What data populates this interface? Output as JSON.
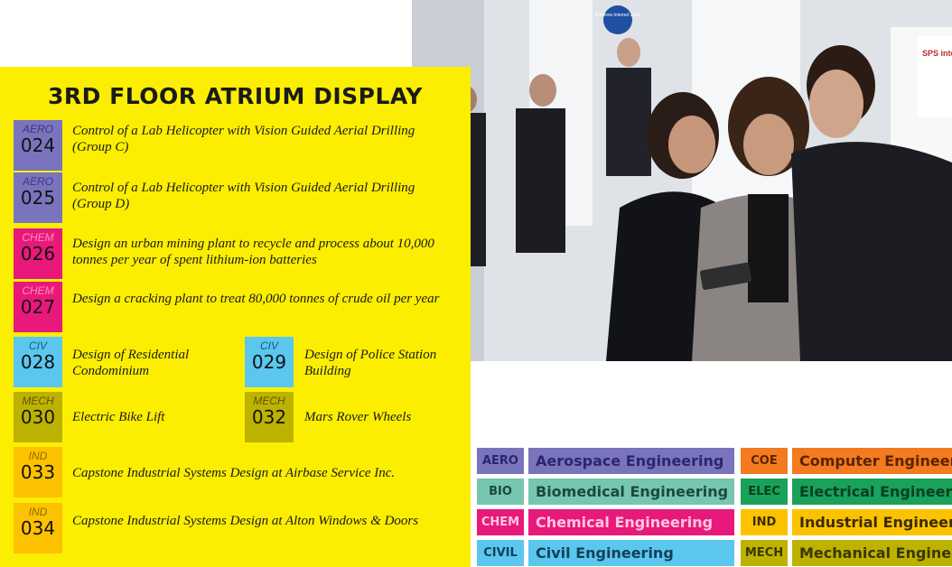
{
  "panel": {
    "title": "3RD FLOOR ATRIUM DISPLAY",
    "projects": [
      {
        "dept": "AERO",
        "num": "024",
        "title": "Control of a Lab Helicopter with Vision Guided Aerial Drilling (Group C)"
      },
      {
        "dept": "AERO",
        "num": "025",
        "title": "Control of a Lab Helicopter with Vision Guided Aerial Drilling (Group D)"
      },
      {
        "dept": "CHEM",
        "num": "026",
        "title": "Design an urban mining plant to recycle and process about 10,000 tonnes per year of spent lithium-ion batteries"
      },
      {
        "dept": "CHEM",
        "num": "027",
        "title": "Design a cracking plant to treat 80,000 tonnes of crude oil per year"
      },
      {
        "dept": "CIV",
        "num": "028",
        "title": "Design of Residential Condominium"
      },
      {
        "dept": "CIV",
        "num": "029",
        "title": "Design of Police Station Building"
      },
      {
        "dept": "MECH",
        "num": "030",
        "title": "Electric Bike Lift"
      },
      {
        "dept": "MECH",
        "num": "032",
        "title": "Mars Rover Wheels"
      },
      {
        "dept": "IND",
        "num": "033",
        "title": "Capstone Industrial Systems Design at Airbase Service Inc."
      },
      {
        "dept": "IND",
        "num": "034",
        "title": "Capstone Industrial Systems Design at Alton Windows & Doors"
      }
    ]
  },
  "photo": {
    "sign_text": "Wireless Internet Zone",
    "poster_text": "SPS intec"
  },
  "legend": [
    {
      "abbr": "AERO",
      "name": "Aerospace Engineering",
      "color": "#7a74bd",
      "text": "#2a2670"
    },
    {
      "abbr": "BIO",
      "name": "Biomedical Engineering",
      "color": "#77c6b0",
      "text": "#1a4a3c"
    },
    {
      "abbr": "CHEM",
      "name": "Chemical Engineering",
      "color": "#e8197a",
      "text": "#ffc6df"
    },
    {
      "abbr": "CIVIL",
      "name": "Civil Engineering",
      "color": "#5bc6ee",
      "text": "#133f58"
    },
    {
      "abbr": "COE",
      "name": "Computer Engineering",
      "color": "#f47a1f",
      "text": "#5a2400"
    },
    {
      "abbr": "ELEC",
      "name": "Electrical Engineering",
      "color": "#1aa15a",
      "text": "#064020"
    },
    {
      "abbr": "IND",
      "name": "Industrial Engineering",
      "color": "#fcc200",
      "text": "#3a2c00"
    },
    {
      "abbr": "MECH",
      "name": "Mechanical Engineering",
      "color": "#bdb200",
      "text": "#3a3600"
    }
  ]
}
